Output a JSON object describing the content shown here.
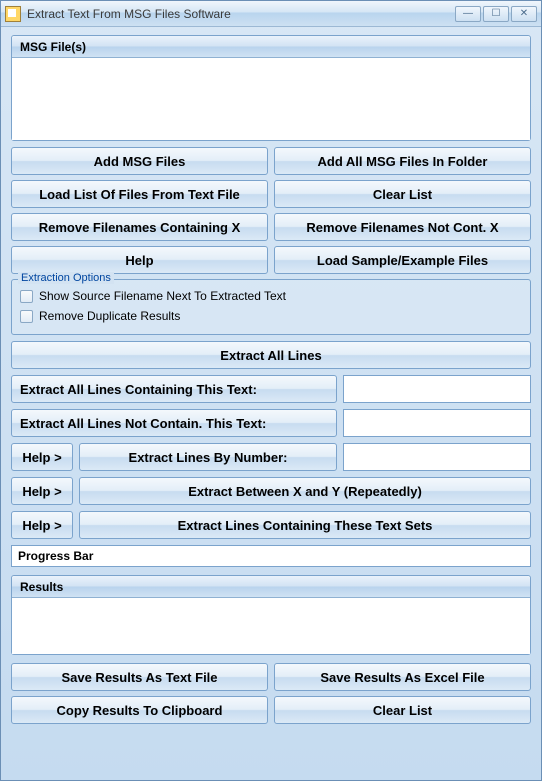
{
  "window": {
    "title": "Extract Text From MSG Files Software"
  },
  "fileListHeader": "MSG File(s)",
  "buttons": {
    "addMsg": "Add MSG Files",
    "addAllFolder": "Add All MSG Files In Folder",
    "loadListFromText": "Load List Of Files From Text File",
    "clearList": "Clear List",
    "removeContaining": "Remove Filenames Containing X",
    "removeNotContaining": "Remove Filenames Not Cont. X",
    "help": "Help",
    "loadSample": "Load Sample/Example Files",
    "extractAll": "Extract All Lines",
    "extractContainingLabel": "Extract All Lines Containing This Text:",
    "extractNotContainingLabel": "Extract All Lines Not Contain. This Text:",
    "helpArrow": "Help >",
    "extractByNumber": "Extract Lines By Number:",
    "extractBetween": "Extract Between X and Y (Repeatedly)",
    "extractTextSets": "Extract Lines Containing These Text Sets",
    "saveText": "Save Results As Text File",
    "saveExcel": "Save Results As Excel File",
    "copyClipboard": "Copy Results To Clipboard",
    "clearList2": "Clear List"
  },
  "options": {
    "legend": "Extraction Options",
    "showSource": "Show Source Filename Next To Extracted Text",
    "removeDup": "Remove Duplicate Results"
  },
  "progress": "Progress Bar",
  "resultsHeader": "Results",
  "inputs": {
    "containing": "",
    "notContaining": "",
    "byNumber": ""
  }
}
